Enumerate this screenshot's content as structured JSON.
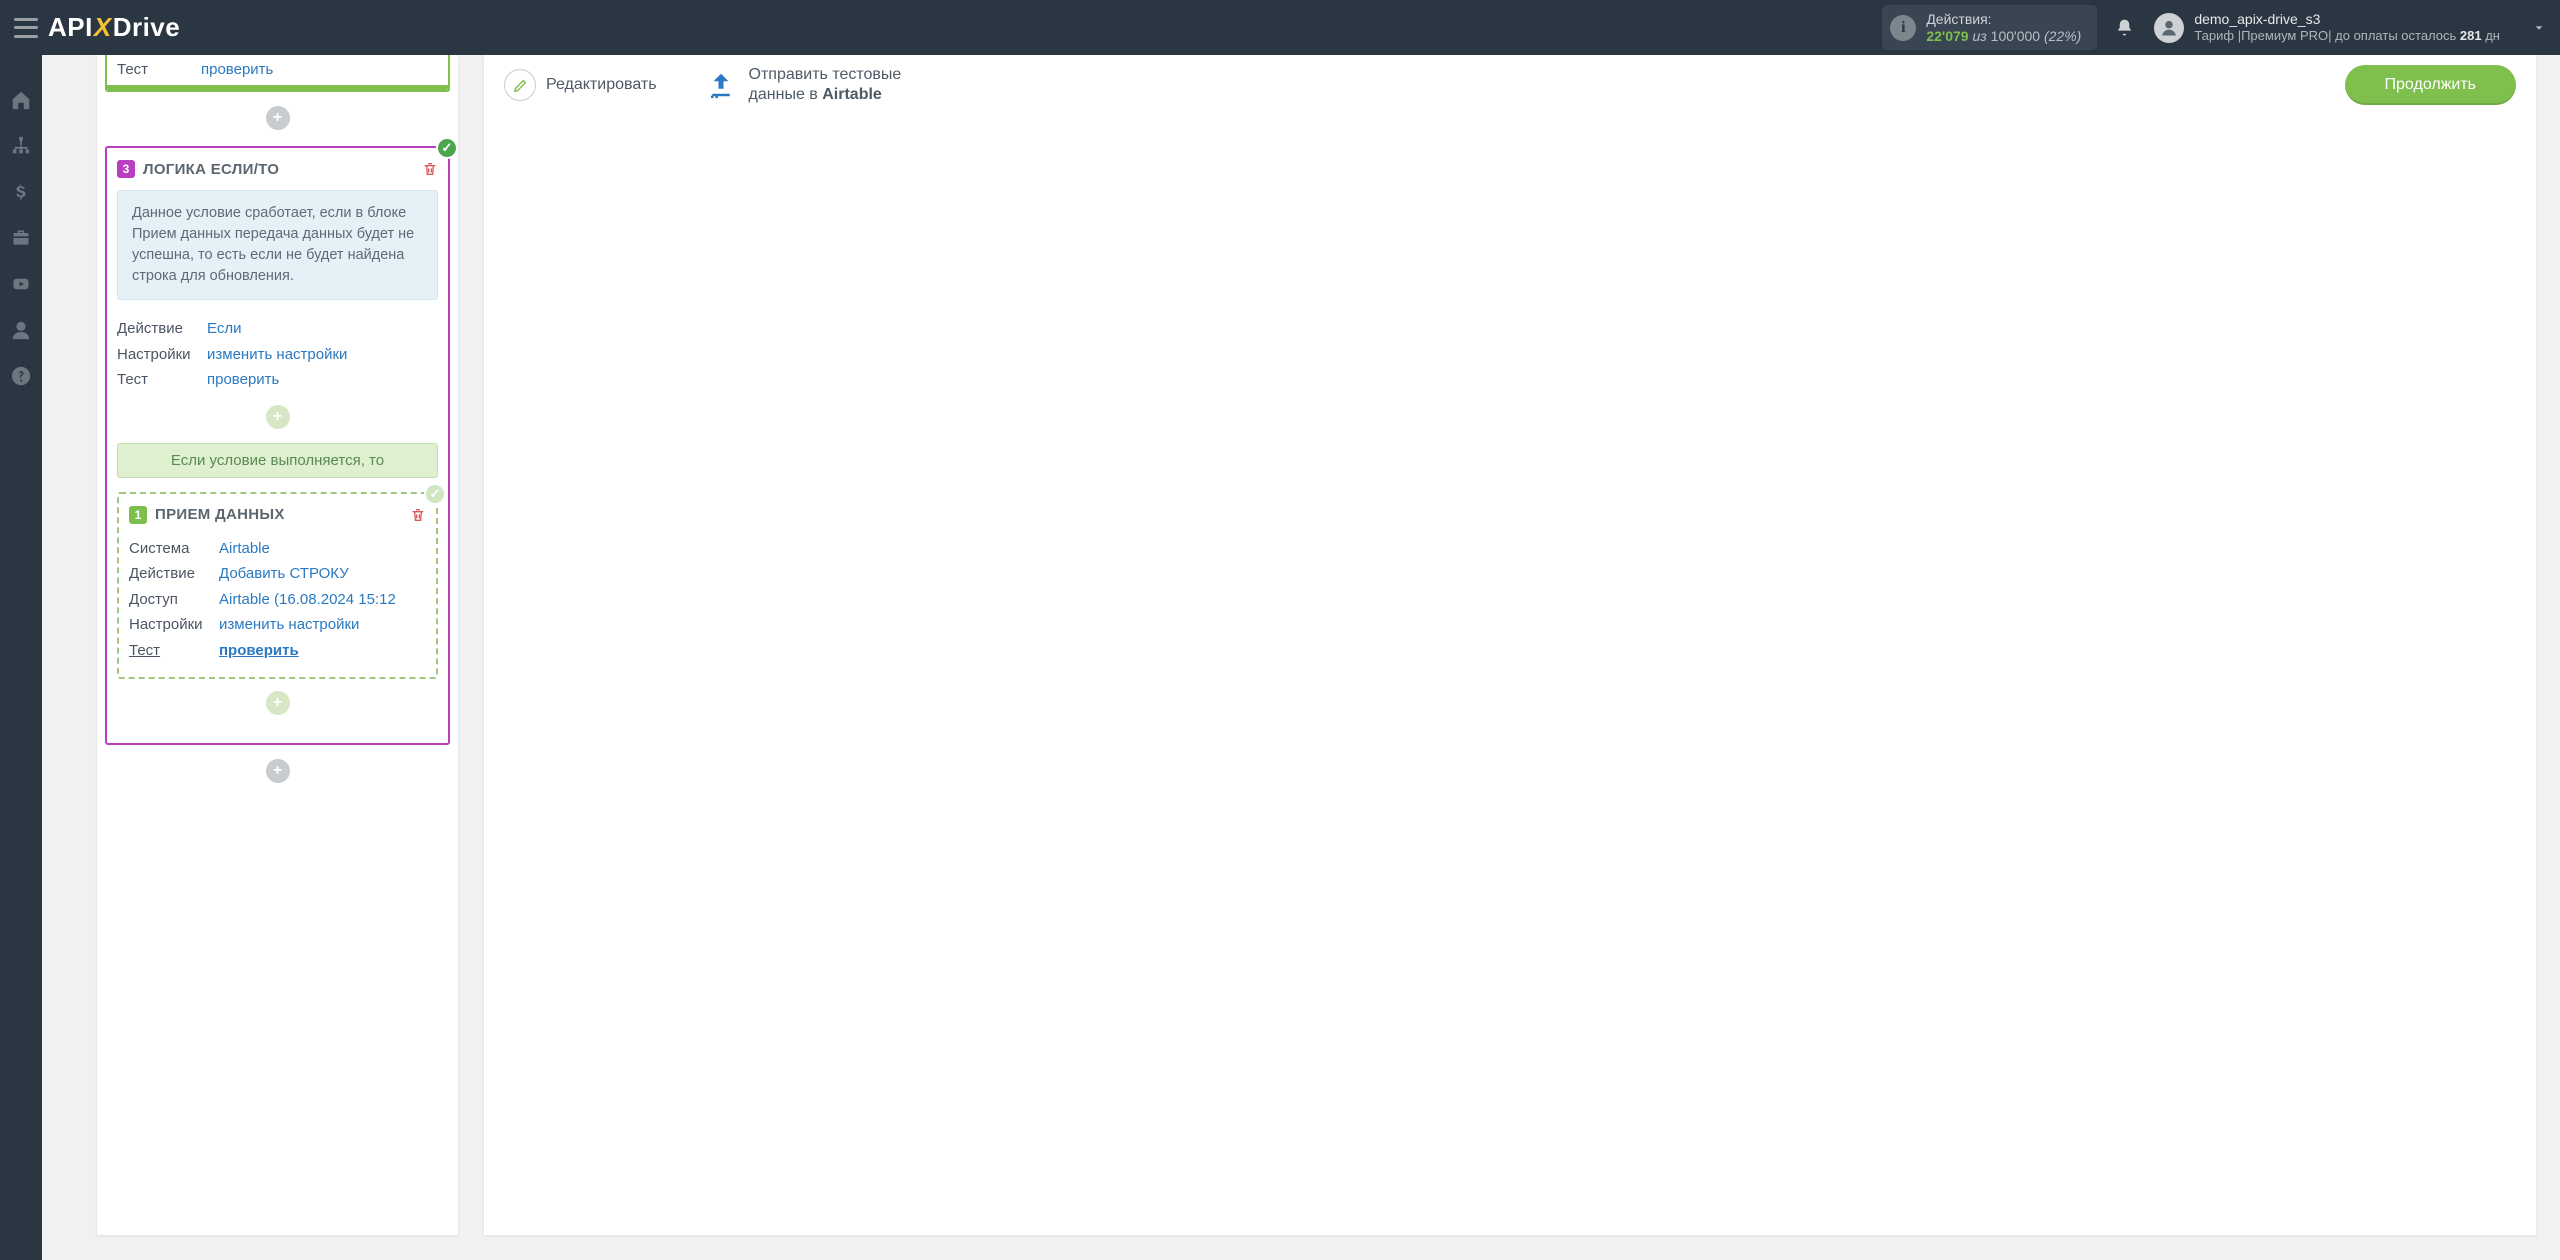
{
  "topbar": {
    "logo_api": "API",
    "logo_x": "X",
    "logo_drive": "Drive",
    "actions": {
      "label": "Действия:",
      "used": "22'079",
      "of": "из",
      "limit": "100'000",
      "pct": "(22%)"
    },
    "user": {
      "name": "demo_apix-drive_s3",
      "plan_label": "Тариф |Премиум PRO| до оплаты осталось ",
      "days": "281",
      "days_suffix": " дн"
    }
  },
  "left": {
    "prev_card": {
      "test_label": "Тест",
      "test_link": "проверить"
    },
    "logic_card": {
      "step": "3",
      "title": "ЛОГИКА ЕСЛИ/ТО",
      "description": "Данное условие сработает, если в блоке Прием данных передача данных будет не успешна, то есть если не будет найдена строка для обновления.",
      "rows": {
        "action_k": "Действие",
        "action_v": "Если",
        "settings_k": "Настройки",
        "settings_v": "изменить настройки",
        "test_k": "Тест",
        "test_v": "проверить"
      },
      "if_bar": "Если условие выполняется, то",
      "inner": {
        "step": "1",
        "title": "ПРИЕМ ДАННЫХ",
        "rows": {
          "system_k": "Система",
          "system_v": "Airtable",
          "action_k": "Действие",
          "action_v": "Добавить СТРОКУ",
          "access_k": "Доступ",
          "access_v": "Airtable (16.08.2024 15:12",
          "settings_k": "Настройки",
          "settings_v": "изменить настройки",
          "test_k": "Тест",
          "test_v": "проверить"
        }
      }
    }
  },
  "right": {
    "edit_label": "Редактировать",
    "send_line1": "Отправить тестовые",
    "send_line2_pre": "данные в ",
    "send_line2_bold": "Airtable",
    "continue": "Продолжить"
  }
}
